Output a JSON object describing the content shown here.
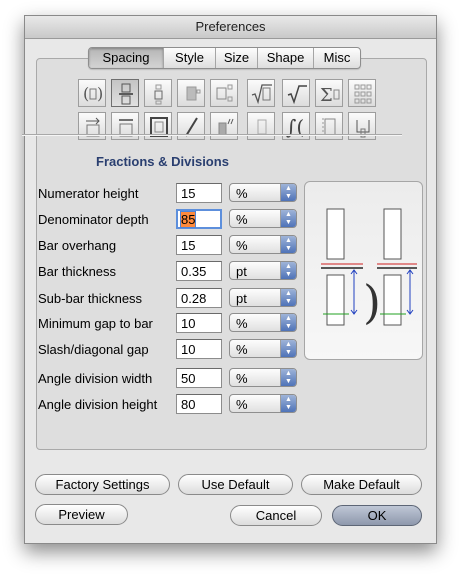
{
  "window": {
    "title": "Preferences"
  },
  "tabs": [
    {
      "label": "Spacing",
      "active": true
    },
    {
      "label": "Style",
      "active": false
    },
    {
      "label": "Size",
      "active": false
    },
    {
      "label": "Shape",
      "active": false
    },
    {
      "label": "Misc",
      "active": false
    }
  ],
  "icon_buttons": {
    "row1": [
      "parentheses-icon",
      "fraction-icon",
      "subscript-icon",
      "tabular-icon",
      "matrix-column-icon",
      "radical-icon",
      "radical-small-icon",
      "summation-icon",
      "grid-icon"
    ],
    "row2": [
      "arrow-icon",
      "bar-icon",
      "box-icon",
      "slash-icon",
      "italic-icon",
      "border-icon",
      "integral-icon",
      "bracket-icon",
      "embellishment-icon"
    ],
    "selected": "fraction-icon"
  },
  "section": {
    "title": "Fractions & Divisions"
  },
  "fields": [
    {
      "label": "Numerator height",
      "value": "15",
      "unit": "%"
    },
    {
      "label": "Denominator depth",
      "value": "85",
      "unit": "%",
      "selected": true
    },
    {
      "label": "Bar overhang",
      "value": "15",
      "unit": "%"
    },
    {
      "label": "Bar thickness",
      "value": "0.35",
      "unit": "pt"
    },
    {
      "label": "Sub-bar thickness",
      "value": "0.28",
      "unit": "pt"
    },
    {
      "label": "Minimum gap to bar",
      "value": "10",
      "unit": "%"
    },
    {
      "label": "Slash/diagonal gap",
      "value": "10",
      "unit": "%"
    },
    {
      "label": "Angle division width",
      "value": "50",
      "unit": "%"
    },
    {
      "label": "Angle division height",
      "value": "80",
      "unit": "%"
    }
  ],
  "buttons": {
    "factory": "Factory Settings",
    "use_default": "Use Default",
    "make_default": "Make Default",
    "preview": "Preview",
    "cancel": "Cancel",
    "ok": "OK"
  },
  "colors": {
    "selected_field": "#ff8a3c",
    "section_title": "#2a3f70",
    "preview_red": "#d02020",
    "preview_blue": "#2040c0",
    "preview_green": "#20a020"
  }
}
